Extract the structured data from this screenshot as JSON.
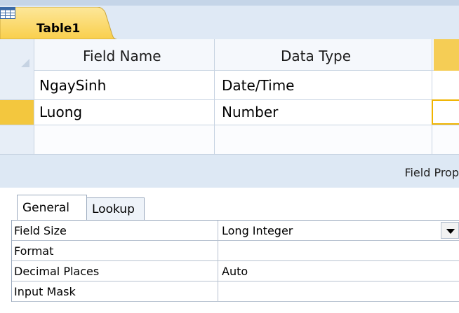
{
  "tab": {
    "label": "Table1",
    "icon": "table-icon"
  },
  "grid": {
    "headers": {
      "field_name": "Field Name",
      "data_type": "Data Type"
    },
    "rows": [
      {
        "field_name": "NgaySinh",
        "data_type": "Date/Time"
      },
      {
        "field_name": "Luong",
        "data_type": "Number"
      }
    ],
    "current_row": 1
  },
  "properties": {
    "title": "Field Prop",
    "tabs": [
      {
        "label": "General",
        "active": true
      },
      {
        "label": "Lookup",
        "active": false
      }
    ],
    "rows": [
      {
        "label": "Field Size",
        "value": "Long Integer",
        "has_dropdown": true
      },
      {
        "label": "Format",
        "value": ""
      },
      {
        "label": "Decimal Places",
        "value": "Auto"
      },
      {
        "label": "Input Mask",
        "value": ""
      }
    ]
  },
  "colors": {
    "selection": "#f3c73e",
    "tab_fill": "#fbd65c",
    "grid_line": "#c8d4e2"
  }
}
